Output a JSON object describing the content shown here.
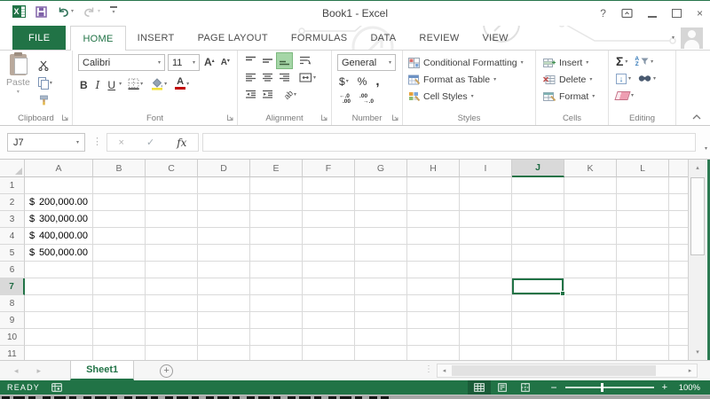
{
  "window": {
    "title": "Book1 - Excel"
  },
  "ribbon_tabs": [
    {
      "label": "FILE",
      "file": true
    },
    {
      "label": "HOME",
      "active": true
    },
    {
      "label": "INSERT"
    },
    {
      "label": "PAGE LAYOUT"
    },
    {
      "label": "FORMULAS"
    },
    {
      "label": "DATA"
    },
    {
      "label": "REVIEW"
    },
    {
      "label": "VIEW"
    }
  ],
  "ribbon": {
    "clipboard": {
      "label": "Clipboard",
      "paste": "Paste"
    },
    "font": {
      "label": "Font",
      "name": "Calibri",
      "size": "11"
    },
    "alignment": {
      "label": "Alignment"
    },
    "number": {
      "label": "Number",
      "format": "General"
    },
    "styles": {
      "label": "Styles",
      "items": [
        "Conditional Formatting",
        "Format as Table",
        "Cell Styles"
      ]
    },
    "cells": {
      "label": "Cells",
      "items": [
        "Insert",
        "Delete",
        "Format"
      ]
    },
    "editing": {
      "label": "Editing"
    }
  },
  "formula_bar": {
    "name_box": "J7",
    "formula": ""
  },
  "grid": {
    "columns": [
      "A",
      "B",
      "C",
      "D",
      "E",
      "F",
      "G",
      "H",
      "I",
      "J",
      "K",
      "L"
    ],
    "rows": [
      "1",
      "2",
      "3",
      "4",
      "5",
      "6",
      "7",
      "8",
      "9",
      "10",
      "11"
    ],
    "selected_column": "J",
    "selected_row": "7",
    "active_cell": "J7",
    "cells": {
      "A2": {
        "currency": "$",
        "amount": "200,000.00"
      },
      "A3": {
        "currency": "$",
        "amount": "300,000.00"
      },
      "A4": {
        "currency": "$",
        "amount": "400,000.00"
      },
      "A5": {
        "currency": "$",
        "amount": "500,000.00"
      }
    }
  },
  "sheet_tabs": {
    "tabs": [
      "Sheet1"
    ],
    "active": "Sheet1"
  },
  "status_bar": {
    "mode": "READY",
    "zoom": "100%"
  },
  "icons": {
    "caret": "▾",
    "help": "?",
    "close": "×",
    "cancel": "×",
    "enter": "✓",
    "fx": "fx",
    "sigma": "Σ",
    "dollar": "$",
    "percent": "%",
    "comma": ",",
    "bold": "B",
    "italic": "I",
    "underline": "U",
    "grow_font": "A",
    "shrink_font": "A",
    "orientation": "ab",
    "sort_a": "A",
    "sort_z": "Z",
    "fill_down": "↓",
    "dots": "⋮",
    "nav_left": "◂",
    "nav_right": "▸",
    "scroll_up": "▴",
    "scroll_down": "▾",
    "add_sheet": "+",
    "zoom_out": "−",
    "zoom_in": "+",
    "inc_dec_top": "←.0",
    "inc_dec_bot": ".00",
    "dec_dec_top": ".00",
    "dec_dec_bot": "→.0"
  },
  "colors": {
    "accent_green": "#217346",
    "selection_green": "#217346",
    "save_icon_purple": "#8062a8",
    "fill_yellow": "#f3e23c",
    "font_color_red": "#c00000",
    "statusbar_green": "#217346"
  }
}
